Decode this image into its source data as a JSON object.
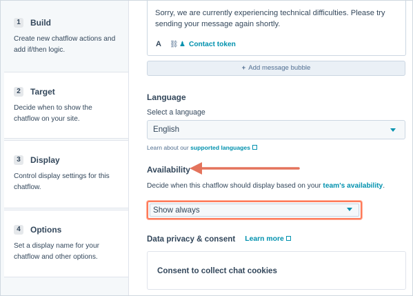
{
  "sidebar": {
    "steps": [
      {
        "num": "1",
        "title": "Build",
        "desc": "Create new chatflow actions and add if/then logic."
      },
      {
        "num": "2",
        "title": "Target",
        "desc": "Decide when to show the chatflow on your site."
      },
      {
        "num": "3",
        "title": "Display",
        "desc": "Control display settings for this chatflow."
      },
      {
        "num": "4",
        "title": "Options",
        "desc": "Set a display name for your chatflow and other options."
      }
    ]
  },
  "message": {
    "text": "Sorry, we are currently experiencing technical difficulties. Please try sending your message again shortly.",
    "tool_text": "A",
    "contact_token": "Contact token",
    "add_bubble": "Add message bubble"
  },
  "language": {
    "heading": "Language",
    "label": "Select a language",
    "value": "English",
    "help_prefix": "Learn about our",
    "help_link": "supported languages"
  },
  "availability": {
    "heading": "Availability",
    "desc_prefix": "Decide when this chatflow should display based on your",
    "desc_link": "team's availability",
    "desc_suffix": ".",
    "value": "Show always"
  },
  "privacy": {
    "heading": "Data privacy & consent",
    "learn_more": "Learn more",
    "consent_title": "Consent to collect chat cookies"
  },
  "colors": {
    "accent": "#0091ae",
    "highlight": "#ff7a59",
    "text": "#33475b"
  }
}
